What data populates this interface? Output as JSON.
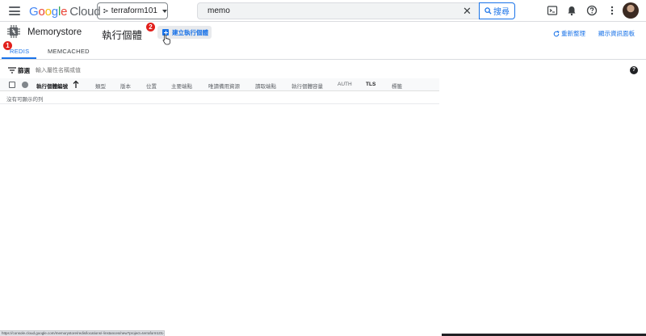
{
  "header": {
    "logo": {
      "google": "Google",
      "cloud": "Cloud"
    },
    "project": "terraform101",
    "search": {
      "value": "memo",
      "button_label": "搜尋"
    }
  },
  "product": {
    "name": "Memorystore",
    "page_title": "執行個體",
    "create_button": "建立執行個體",
    "refresh_button": "重新整理",
    "info_panel_button": "顯示資訊面板"
  },
  "badges": {
    "tab_step": "1",
    "create_step": "2"
  },
  "tabs": [
    {
      "label": "REDIS",
      "active": true
    },
    {
      "label": "MEMCACHED",
      "active": false
    }
  ],
  "filter": {
    "label": "篩選",
    "placeholder": "輸入屬性名稱或值"
  },
  "table": {
    "columns": [
      "執行個體編號",
      "類型",
      "版本",
      "位置",
      "主要端點",
      "唯讀備用資源",
      "讀取端點",
      "執行個體容量",
      "AUTH",
      "TLS",
      "標籤"
    ],
    "empty_message": "沒有可顯示的列"
  },
  "status_url": "https://console.cloud.google.com/memorystore/redis/locations/-/instances/new?project=terraform101-384837",
  "colors": {
    "accent": "#1a73e8",
    "badge": "#e2201c"
  }
}
